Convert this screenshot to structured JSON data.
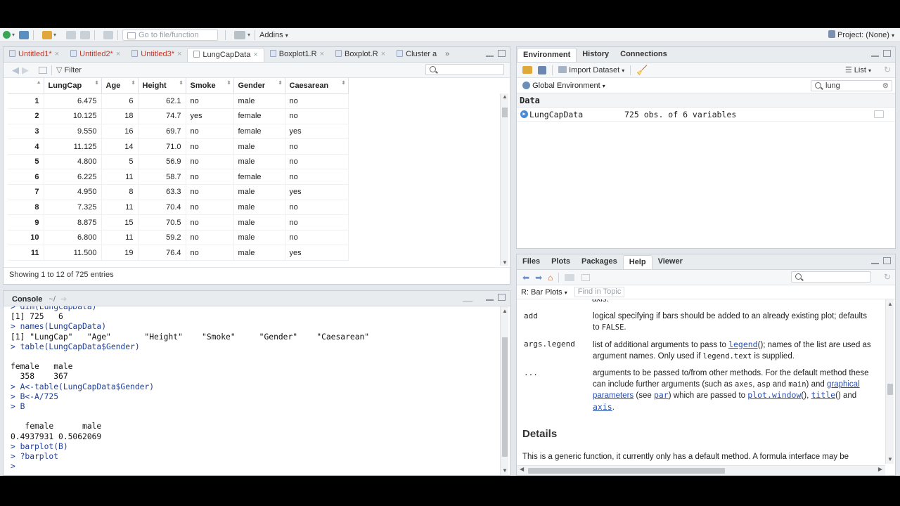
{
  "toolbar": {
    "goto_placeholder": "Go to file/function",
    "addins_label": "Addins",
    "project_label": "Project: (None)"
  },
  "source": {
    "tabs": [
      {
        "label": "Untitled1*"
      },
      {
        "label": "Untitled2*"
      },
      {
        "label": "Untitled3*"
      },
      {
        "label": "LungCapData"
      },
      {
        "label": "Boxplot1.R"
      },
      {
        "label": "Boxplot.R"
      },
      {
        "label": "Cluster a"
      }
    ],
    "filter_label": "Filter",
    "columns": [
      "LungCap",
      "Age",
      "Height",
      "Smoke",
      "Gender",
      "Caesarean"
    ],
    "rows": [
      [
        "1",
        "6.475",
        "6",
        "62.1",
        "no",
        "male",
        "no"
      ],
      [
        "2",
        "10.125",
        "18",
        "74.7",
        "yes",
        "female",
        "no"
      ],
      [
        "3",
        "9.550",
        "16",
        "69.7",
        "no",
        "female",
        "yes"
      ],
      [
        "4",
        "11.125",
        "14",
        "71.0",
        "no",
        "male",
        "no"
      ],
      [
        "5",
        "4.800",
        "5",
        "56.9",
        "no",
        "male",
        "no"
      ],
      [
        "6",
        "6.225",
        "11",
        "58.7",
        "no",
        "female",
        "no"
      ],
      [
        "7",
        "4.950",
        "8",
        "63.3",
        "no",
        "male",
        "yes"
      ],
      [
        "8",
        "7.325",
        "11",
        "70.4",
        "no",
        "male",
        "no"
      ],
      [
        "9",
        "8.875",
        "15",
        "70.5",
        "no",
        "male",
        "no"
      ],
      [
        "10",
        "6.800",
        "11",
        "59.2",
        "no",
        "male",
        "no"
      ],
      [
        "11",
        "11.500",
        "19",
        "76.4",
        "no",
        "male",
        "yes"
      ]
    ],
    "status": "Showing 1 to 12 of 725 entries"
  },
  "console": {
    "title": "Console",
    "path": "~/",
    "lines": [
      {
        "t": "cmd",
        "s": "> dim(LungCapData)"
      },
      {
        "t": "res",
        "s": "[1] 725   6"
      },
      {
        "t": "cmd",
        "s": "> names(LungCapData)"
      },
      {
        "t": "res",
        "s": "[1] \"LungCap\"   \"Age\"       \"Height\"    \"Smoke\"     \"Gender\"    \"Caesarean\""
      },
      {
        "t": "cmd",
        "s": "> table(LungCapData$Gender)"
      },
      {
        "t": "res",
        "s": ""
      },
      {
        "t": "res",
        "s": "female   male"
      },
      {
        "t": "res",
        "s": "  358    367"
      },
      {
        "t": "cmd",
        "s": "> A<-table(LungCapData$Gender)"
      },
      {
        "t": "cmd",
        "s": "> B<-A/725"
      },
      {
        "t": "cmd",
        "s": "> B"
      },
      {
        "t": "res",
        "s": ""
      },
      {
        "t": "res",
        "s": "   female      male"
      },
      {
        "t": "res",
        "s": "0.4937931 0.5062069"
      },
      {
        "t": "cmd",
        "s": "> barplot(B)"
      },
      {
        "t": "cmd",
        "s": "> ?barplot"
      },
      {
        "t": "cmd",
        "s": ">"
      }
    ]
  },
  "env": {
    "tabs": [
      "Environment",
      "History",
      "Connections"
    ],
    "import_label": "Import Dataset",
    "list_label": "List",
    "global_env_label": "Global Environment",
    "search_value": "lung",
    "section": "Data",
    "items": [
      {
        "name": "LungCapData",
        "value": "725 obs. of 6 variables"
      }
    ]
  },
  "help": {
    "tabs": [
      "Files",
      "Plots",
      "Packages",
      "Help",
      "Viewer"
    ],
    "topic": "R: Bar Plots",
    "find_placeholder": "Find in Topic",
    "top_fragment": "axis.",
    "add_term": "add",
    "add_desc_1": "logical specifying if bars should be added to an already existing plot; defaults to",
    "add_desc_code": "FALSE",
    "legend_term": "args.legend",
    "legend_desc_1": "list of additional arguments to pass to",
    "legend_link": "legend",
    "legend_desc_2": "(); names of the list are used as argument names. Only used if",
    "legend_code": "legend.text",
    "legend_desc_3": "is supplied.",
    "dots_term": "...",
    "dots_desc_1": "arguments to be passed to/from other methods. For the default method these can include further arguments (such as",
    "dots_code_axes": "axes",
    "dots_code_asp": "asp",
    "dots_and": "and",
    "dots_code_main": "main",
    "dots_desc_2": ") and",
    "dots_link_gp": "graphical parameters",
    "dots_see": "(see",
    "dots_link_par": "par",
    "dots_desc_3": ") which are passed to",
    "dots_link_pw": "plot.window",
    "dots_paren": "(),",
    "dots_link_title": "title",
    "dots_and2": "() and",
    "dots_link_axis": "axis",
    "dots_end": ".",
    "details_heading": "Details",
    "details_text": "This is a generic function, it currently only has a default method. A formula interface may be"
  }
}
